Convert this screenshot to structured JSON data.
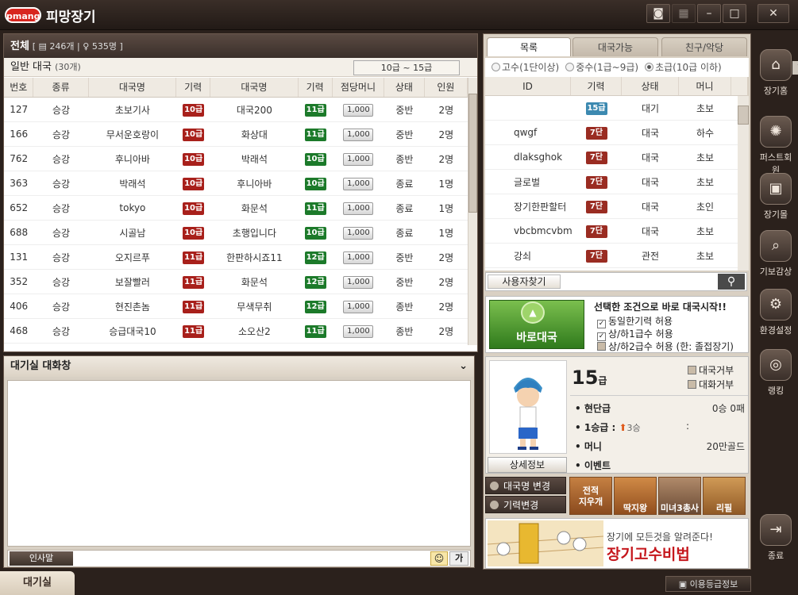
{
  "app": {
    "logo": "pmang",
    "title": "피망장기"
  },
  "window_buttons": [
    "camera-icon",
    "grid-icon",
    "minimize-icon",
    "maximize-icon",
    "close-icon"
  ],
  "rooms": {
    "filter_label": "전체",
    "room_count": "246개",
    "user_count": "535명",
    "section_title": "일반 대국",
    "section_count": "(30개)",
    "grade_range": "10급 ~ 15급",
    "columns": [
      "번호",
      "종류",
      "대국명",
      "기력",
      "대국명",
      "기력",
      "점당머니",
      "상태",
      "인원"
    ],
    "rows": [
      {
        "no": "127",
        "type": "승강",
        "name1": "초보기사",
        "grade1": "10급",
        "c1": "red",
        "name2": "대국200",
        "grade2": "11급",
        "c2": "green",
        "money": "1,000",
        "status": "중반",
        "people": "2명"
      },
      {
        "no": "166",
        "type": "승강",
        "name1": "무서운호랑이",
        "grade1": "10급",
        "c1": "red",
        "name2": "화상대",
        "grade2": "11급",
        "c2": "green",
        "money": "1,000",
        "status": "중반",
        "people": "2명"
      },
      {
        "no": "762",
        "type": "승강",
        "name1": "후니아바",
        "grade1": "10급",
        "c1": "red",
        "name2": "박래석",
        "grade2": "10급",
        "c2": "green",
        "money": "1,000",
        "status": "종반",
        "people": "2명"
      },
      {
        "no": "363",
        "type": "승강",
        "name1": "박래석",
        "grade1": "10급",
        "c1": "red",
        "name2": "후니아바",
        "grade2": "10급",
        "c2": "green",
        "money": "1,000",
        "status": "종료",
        "people": "1명"
      },
      {
        "no": "652",
        "type": "승강",
        "name1": "tokyo",
        "grade1": "10급",
        "c1": "red",
        "name2": "화문석",
        "grade2": "11급",
        "c2": "green",
        "money": "1,000",
        "status": "종료",
        "people": "1명"
      },
      {
        "no": "688",
        "type": "승강",
        "name1": "시골남",
        "grade1": "10급",
        "c1": "red",
        "name2": "초행입니다",
        "grade2": "10급",
        "c2": "green",
        "money": "1,000",
        "status": "종료",
        "people": "1명"
      },
      {
        "no": "131",
        "type": "승강",
        "name1": "오지르푸",
        "grade1": "11급",
        "c1": "red",
        "name2": "한판하시죠11",
        "grade2": "12급",
        "c2": "green",
        "money": "1,000",
        "status": "중반",
        "people": "2명"
      },
      {
        "no": "352",
        "type": "승강",
        "name1": "보잘빨러",
        "grade1": "11급",
        "c1": "red",
        "name2": "화문석",
        "grade2": "12급",
        "c2": "green",
        "money": "1,000",
        "status": "중반",
        "people": "2명"
      },
      {
        "no": "406",
        "type": "승강",
        "name1": "현진촌놈",
        "grade1": "11급",
        "c1": "red",
        "name2": "무색무취",
        "grade2": "12급",
        "c2": "green",
        "money": "1,000",
        "status": "종반",
        "people": "2명"
      },
      {
        "no": "468",
        "type": "승강",
        "name1": "승급대국10",
        "grade1": "11급",
        "c1": "red",
        "name2": "소오산2",
        "grade2": "11급",
        "c2": "green",
        "money": "1,000",
        "status": "종반",
        "people": "2명"
      }
    ]
  },
  "chat": {
    "title": "대기실 대화창",
    "greet_label": "인사말",
    "font_label": "가"
  },
  "bottom": {
    "lobby_tab": "대기실",
    "grade_info": "이용등급정보"
  },
  "users": {
    "tabs": [
      "목록",
      "대국가능",
      "친구/악당"
    ],
    "filters": [
      {
        "label": "고수(1단이상)",
        "on": false
      },
      {
        "label": "중수(1급~9급)",
        "on": false
      },
      {
        "label": "초급(10급 이하)",
        "on": true
      }
    ],
    "columns": [
      "ID",
      "기력",
      "상태",
      "머니"
    ],
    "rows": [
      {
        "id": "",
        "grade": "15급",
        "color": "blue",
        "status": "대기",
        "money": "초보"
      },
      {
        "id": "qwgf",
        "grade": "7단",
        "color": "brown",
        "status": "대국",
        "money": "하수"
      },
      {
        "id": "dlaksghok",
        "grade": "7단",
        "color": "brown",
        "status": "대국",
        "money": "초보"
      },
      {
        "id": "글로벌",
        "grade": "7단",
        "color": "brown",
        "status": "대국",
        "money": "초보"
      },
      {
        "id": "장기한판할터",
        "grade": "7단",
        "color": "brown",
        "status": "대국",
        "money": "초인"
      },
      {
        "id": "vbcbmcvbm",
        "grade": "7단",
        "color": "brown",
        "status": "대국",
        "money": "초보"
      },
      {
        "id": "강쇠",
        "grade": "7단",
        "color": "brown",
        "status": "관전",
        "money": "초보"
      }
    ],
    "search_label": "사용자찾기"
  },
  "quick": {
    "button": "바로대국",
    "title": "선택한 조건으로 바로 대국시작!!",
    "options": [
      {
        "label": "동일한기력 허용",
        "on": true
      },
      {
        "label": "상/하1급수 허용",
        "on": true
      },
      {
        "label": "상/하2급수 허용 (한: 졸접장기)",
        "on": false
      }
    ]
  },
  "profile": {
    "grade": "15",
    "grade_unit": "급",
    "refuse_game": "대국거부",
    "refuse_chat": "대화거부",
    "record_label": "현단급",
    "record_value": "0승 0패",
    "promotion_label": "1승급 :",
    "promotion_value": "3승",
    "promotion_sep": ":",
    "money_label": "머니",
    "money_value": "20만골드",
    "event_label": "이벤트",
    "detail_button": "상세정보"
  },
  "actions": {
    "rename": "대국명 변경",
    "grade_change": "기력변경",
    "events": [
      "전적\n지우개",
      "딱지왕",
      "미녀3총사",
      "리필"
    ]
  },
  "banner": {
    "line1": "장기에 모든것을 알려준다!",
    "line2": "장기고수비법"
  },
  "side_menu": [
    {
      "label": "장기홈",
      "icon": "home-icon",
      "glyph": "⌂"
    },
    {
      "label": "퍼스트회원",
      "icon": "fan-icon",
      "glyph": "✺"
    },
    {
      "label": "장기몰",
      "icon": "gift-icon",
      "glyph": "▣"
    },
    {
      "label": "기보감상",
      "icon": "review-icon",
      "glyph": "⌕"
    },
    {
      "label": "환경설정",
      "icon": "settings-icon",
      "glyph": "⚙"
    },
    {
      "label": "랭킹",
      "icon": "ranking-icon",
      "glyph": "◎"
    },
    {
      "label": "종료",
      "icon": "exit-icon",
      "glyph": "⇥"
    }
  ]
}
